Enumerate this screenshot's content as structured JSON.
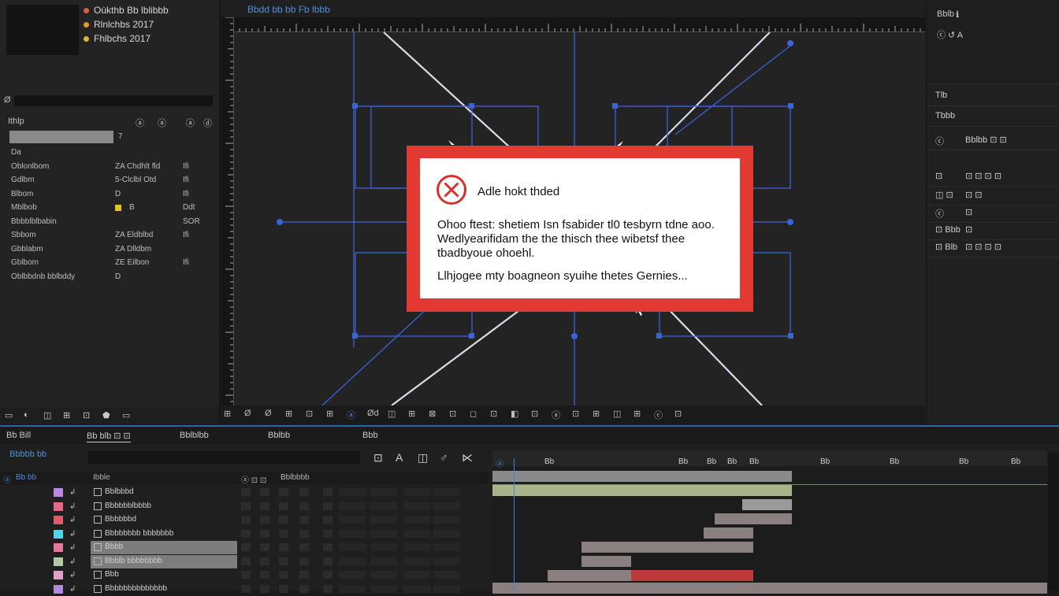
{
  "project": {
    "info": [
      "Oùkthb Bb lblibbb",
      "Rlnlchbs 2017",
      "Fhlbchs 2017"
    ],
    "search_icon": "Ø",
    "columns": [
      "Ithlp",
      "ⓐ",
      "ⓐ",
      "ⓐ",
      "ⓓ"
    ],
    "selected_value": "7",
    "rows": [
      {
        "name": "Da",
        "type": "",
        "ext": ""
      },
      {
        "name": "Oblonlbom",
        "type": "ZA Chdhlt fld",
        "ext": "Ifi"
      },
      {
        "name": "Gdlbm",
        "type": "5-Clclbl Otd",
        "ext": "Ifi"
      },
      {
        "name": "Blbom",
        "type": "D",
        "ext": "Ifi"
      },
      {
        "name": "Mblbob",
        "type": "B",
        "ext": "Ddt"
      },
      {
        "name": "Bbbblblbabin",
        "type": "",
        "ext": "SOR"
      },
      {
        "name": "Sbbom",
        "type": "ZA Eldblbd",
        "ext": "Ifi"
      },
      {
        "name": "Gbblabm",
        "type": "ZA Dlldbm",
        "ext": ""
      },
      {
        "name": "Gblbom",
        "type": "ZE Eilbon",
        "ext": "Ifi"
      },
      {
        "name": "Oblbbdnb bblbddy",
        "type": "D",
        "ext": ""
      }
    ],
    "footer_icons": [
      "▭",
      "◐",
      "◫",
      "⊞",
      "⊡",
      "⬟",
      "▭"
    ]
  },
  "viewer": {
    "tab": "Bbdd bb bb Fb lbbb",
    "toolbar": [
      "⊞",
      "Ø",
      "Ø",
      "⊞",
      "⊡",
      "⊞",
      "ⓐ",
      "Ød",
      "◫",
      "⊞",
      "⊠",
      "⊡",
      "◻",
      "⊡",
      "◧",
      "⊡",
      "ⓐ",
      "⊡",
      "⊞",
      "◫",
      "⊞",
      "ⓒ",
      "⊡"
    ]
  },
  "dialog": {
    "title": "Adle hokt thded",
    "message": "Ohoo ftest: shetiem Isn fsabider tl0 tesbyrn tdne aoo. Wedlyearifidam the the thisch thee wibetsf thee tbadbyoue ohoehl.",
    "footer": "Llhjogee mty boagneon syuihe thetes Gernies..."
  },
  "right": {
    "top_lines": [
      "Bblb",
      "ℹ",
      "ⓒ ↺ A"
    ],
    "rows": [
      {
        "a": "Tlb",
        "b": ""
      },
      {
        "a": "Tbbb",
        "b": ""
      },
      {
        "a": "ⓒ",
        "b": "Bblbb ⊡  ⊡"
      },
      {
        "a": "⊡",
        "b": "⊡   ⊡   ⊡   ⊡"
      },
      {
        "a": "◫ ⊡",
        "b": "⊡         ⊡"
      },
      {
        "a": "ⓒ",
        "b": "⊡"
      },
      {
        "a": "⊡ Bbb",
        "b": "⊡"
      },
      {
        "a": "⊡ Blb",
        "b": "⊡  ⊡  ⊡ ⊡"
      }
    ]
  },
  "timeline": {
    "tabs": [
      "Bb Bill",
      "Bb blb ⊡ ⊡",
      "Bblblbb",
      "Bblbb",
      "Bbb"
    ],
    "timecode": "Bbbbb bb",
    "tool_icons": [
      "⊡",
      "A",
      "◫",
      "♂",
      "⋉"
    ],
    "col_headers": [
      "ⓐ",
      "Bb bb",
      "Ibble",
      "ⓐ ⊡ ⊡",
      "Bblbbbb"
    ],
    "layers": [
      {
        "color": "#b98ae0",
        "name": "Bblbbbd"
      },
      {
        "color": "#e06a8a",
        "name": "Bbbbbblbbbb"
      },
      {
        "color": "#e05a6a",
        "name": "Bbbbbbd"
      },
      {
        "color": "#4fd4e8",
        "name": "Bbbbbbbb bbbbbbb"
      },
      {
        "color": "#e07a9a",
        "name": "Bbbb"
      },
      {
        "color": "#b4c8a8",
        "name": "Bbblb bbbbbbbb"
      },
      {
        "color": "#e0a0c8",
        "name": "Bbb"
      },
      {
        "color": "#b08ae0",
        "name": "Bbbbbbbbbbbbbb"
      }
    ],
    "ruler_ticks": [
      "ⓐ",
      "Bb",
      "Bb",
      "Bb",
      "Bb",
      "Bb",
      "Bb",
      "Bb",
      "Bb",
      "Bb",
      "Bb",
      "Bb",
      "Bb",
      "Bb",
      "Bb"
    ],
    "clips": [
      {
        "start": 0,
        "end": 0.54,
        "color": "#8a8a8a"
      },
      {
        "start": 0,
        "end": 0.54,
        "color": "#a9b48a"
      },
      {
        "start": 0.45,
        "end": 0.54,
        "color": "#9a9a9a"
      },
      {
        "start": 0.4,
        "end": 0.54,
        "color": "#8a8080"
      },
      {
        "start": 0.38,
        "end": 0.47,
        "color": "#8a8080"
      },
      {
        "start": 0.16,
        "end": 0.47,
        "color": "#8a8080"
      },
      {
        "start": 0.16,
        "end": 0.25,
        "color": "#8a8080"
      },
      {
        "start": 0.1,
        "end": 0.25,
        "color": "#8a8080"
      },
      {
        "start": 0.25,
        "end": 0.47,
        "color": "#c0393a"
      },
      {
        "start": 0,
        "end": 1,
        "color": "#8a8080"
      }
    ]
  },
  "colors": {
    "accent": "#3b7fe0",
    "dialog_border": "#e23a33",
    "error_icon": "#d9302a"
  }
}
